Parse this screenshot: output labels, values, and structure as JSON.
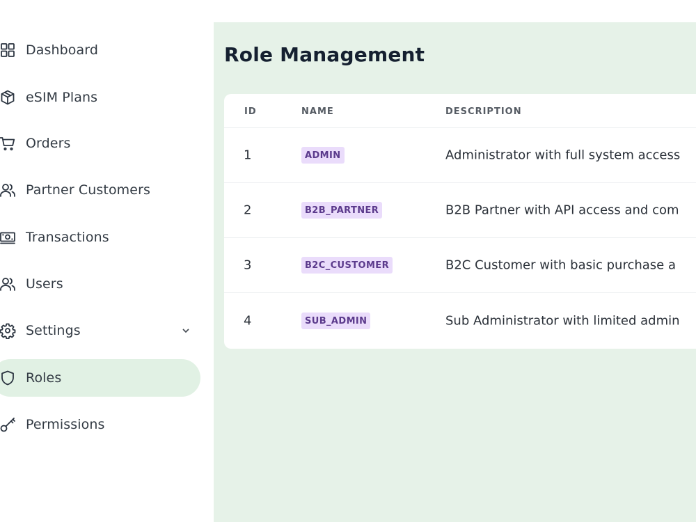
{
  "sidebar": {
    "items": [
      {
        "label": "Dashboard",
        "icon": "grid-icon"
      },
      {
        "label": "eSIM Plans",
        "icon": "box-icon"
      },
      {
        "label": "Orders",
        "icon": "cart-icon"
      },
      {
        "label": "Partner Customers",
        "icon": "users-icon"
      },
      {
        "label": "Transactions",
        "icon": "banknote-icon"
      },
      {
        "label": "Users",
        "icon": "users-icon"
      },
      {
        "label": "Settings",
        "icon": "gear-icon",
        "has_submenu": true
      },
      {
        "label": "Roles",
        "icon": "shield-icon",
        "active": true
      },
      {
        "label": "Permissions",
        "icon": "key-icon"
      }
    ]
  },
  "main": {
    "title": "Role Management",
    "table": {
      "headers": [
        "ID",
        "NAME",
        "DESCRIPTION"
      ],
      "rows": [
        {
          "id": "1",
          "name": "ADMIN",
          "description": "Administrator with full system access"
        },
        {
          "id": "2",
          "name": "B2B_PARTNER",
          "description": "B2B Partner with API access and com"
        },
        {
          "id": "3",
          "name": "B2C_CUSTOMER",
          "description": "B2C Customer with basic purchase a"
        },
        {
          "id": "4",
          "name": "SUB_ADMIN",
          "description": "Sub Administrator with limited admin"
        }
      ]
    }
  },
  "colors": {
    "active_nav_bg": "#e1f1e4",
    "main_bg": "#e6f2e8",
    "badge_bg": "#eadcfb",
    "badge_text": "#5b3a8c"
  }
}
